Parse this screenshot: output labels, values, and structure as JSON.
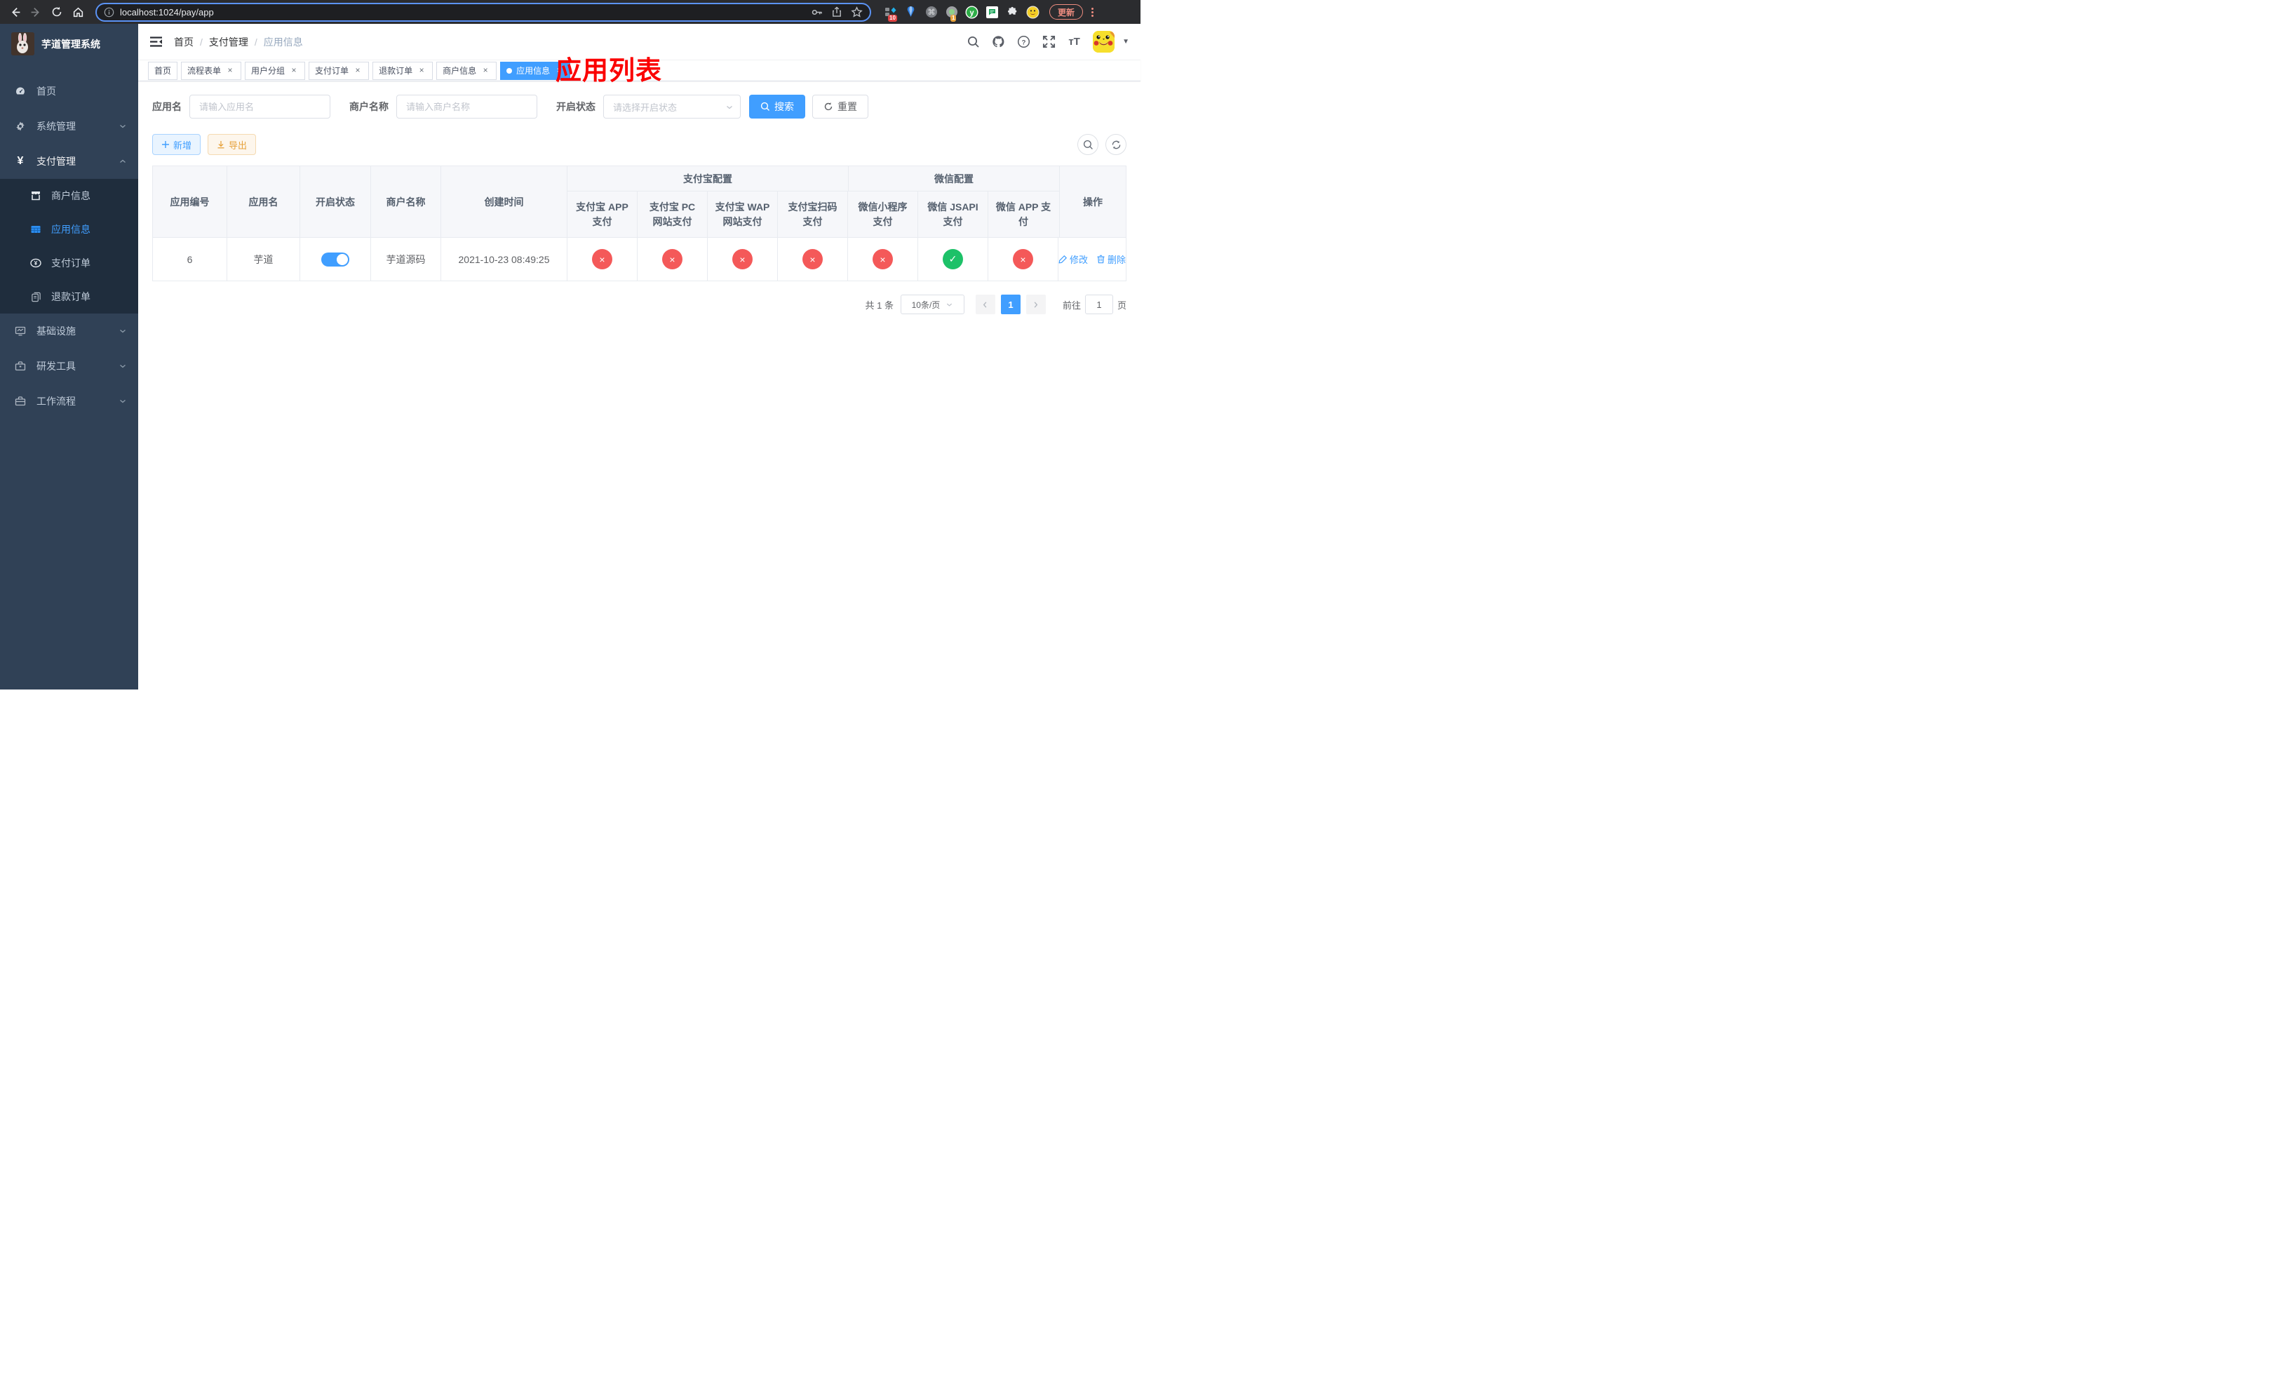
{
  "browser": {
    "url": "localhost:1024/pay/app",
    "update_label": "更新",
    "ext_badge_blue": "10",
    "ext_badge_circle": "1",
    "ext_y_letter": "y"
  },
  "sidebar": {
    "title": "芋道管理系统",
    "items": {
      "home": "首页",
      "system": "系统管理",
      "payment": "支付管理",
      "infra": "基础设施",
      "devtools": "研发工具",
      "workflow": "工作流程"
    },
    "payment_children": {
      "merchant": "商户信息",
      "app": "应用信息",
      "pay_order": "支付订单",
      "refund_order": "退款订单"
    }
  },
  "breadcrumb": {
    "0": "首页",
    "1": "支付管理",
    "2": "应用信息",
    "sep": "/"
  },
  "overlay_title": "应用列表",
  "tags": {
    "0": {
      "label": "首页"
    },
    "1": {
      "label": "流程表单"
    },
    "2": {
      "label": "用户分组"
    },
    "3": {
      "label": "支付订单"
    },
    "4": {
      "label": "退款订单"
    },
    "5": {
      "label": "商户信息"
    },
    "6": {
      "label": "应用信息"
    },
    "close_glyph": "×"
  },
  "filters": {
    "app_name_label": "应用名",
    "app_name_placeholder": "请输入应用名",
    "merchant_label": "商户名称",
    "merchant_placeholder": "请输入商户名称",
    "status_label": "开启状态",
    "status_placeholder": "请选择开启状态",
    "search_label": "搜索",
    "reset_label": "重置"
  },
  "toolbar": {
    "add_label": "新增",
    "export_label": "导出"
  },
  "table": {
    "columns": {
      "0": "应用编号",
      "1": "应用名",
      "2": "开启状态",
      "3": "商户名称",
      "4": "创建时间"
    },
    "groups": {
      "alipay": {
        "label": "支付宝配置",
        "cols": {
          "0": "支付宝 APP 支付",
          "1": "支付宝 PC 网站支付",
          "2": "支付宝 WAP 网站支付",
          "3": "支付宝扫码支付"
        }
      },
      "wechat": {
        "label": "微信配置",
        "cols": {
          "0": "微信小程序支付",
          "1": "微信 JSAPI 支付",
          "2": "微信 APP 支付"
        }
      }
    },
    "action_column": "操作",
    "row": {
      "id": "6",
      "name": "芋道",
      "enabled": true,
      "merchant": "芋道源码",
      "created": "2021-10-23 08:49:25",
      "statuses": [
        "no",
        "no",
        "no",
        "no",
        "no",
        "yes",
        "no"
      ],
      "edit_label": "修改",
      "delete_label": "删除"
    }
  },
  "pagination": {
    "total": "共 1 条",
    "page_size": "10条/页",
    "current": "1",
    "goto_label": "前往",
    "goto_value": "1",
    "page_label": "页"
  }
}
